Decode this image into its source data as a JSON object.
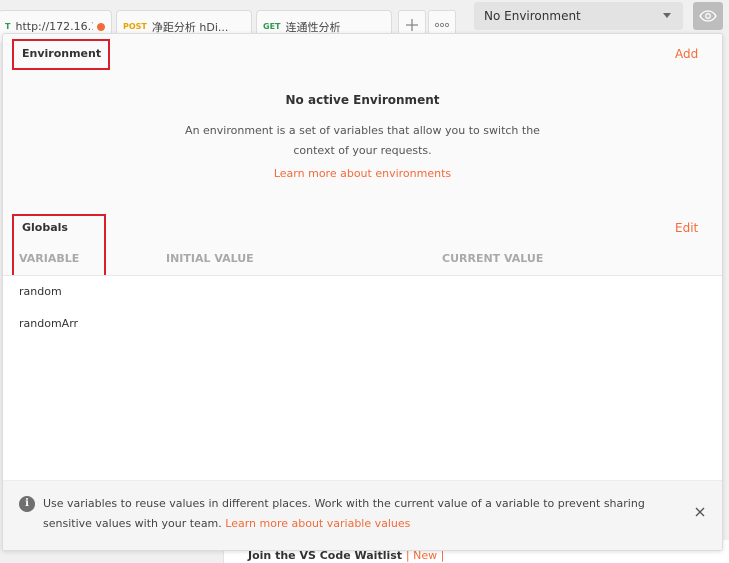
{
  "tabs": [
    {
      "method": "T",
      "title": "http://172.16.1...",
      "unsaved": true
    },
    {
      "method": "POST",
      "title": "净距分析 hDi..."
    },
    {
      "method": "GET",
      "title": "连通性分析"
    }
  ],
  "tab_controls": {
    "add_icon": "plus-icon",
    "more_icon": "ellipsis-icon"
  },
  "environment_selector": {
    "value": "No Environment",
    "icon": "chevron-down-icon"
  },
  "environment_quick_look_icon": "eye-icon",
  "environment": {
    "title": "Environment",
    "action": "Add",
    "empty_title": "No active Environment",
    "empty_desc_line1": "An environment is a set of variables that allow you to switch the",
    "empty_desc_line2": "context of your requests.",
    "learn_link": "Learn more about environments"
  },
  "globals": {
    "title": "Globals",
    "action": "Edit",
    "columns": [
      "VARIABLE",
      "INITIAL VALUE",
      "CURRENT VALUE"
    ],
    "rows": [
      {
        "variable": "random",
        "initial": "",
        "current": ""
      },
      {
        "variable": "randomArr",
        "initial": "",
        "current": ""
      }
    ]
  },
  "info_banner": {
    "icon": "info-icon",
    "text_line1": "Use variables to reuse values in different places. Work with the current value of a variable to prevent sharing",
    "text_line2": "sensitive values with your team.",
    "link": "Learn more about variable values",
    "close_icon": "close-icon"
  },
  "behind_panel": {
    "text": "Join the VS Code Waitlist",
    "badge": "| New |"
  },
  "colors": {
    "accent": "#f26b3a",
    "highlight_box": "#d9202a",
    "get": "#2f9a53",
    "post": "#e6a400"
  }
}
